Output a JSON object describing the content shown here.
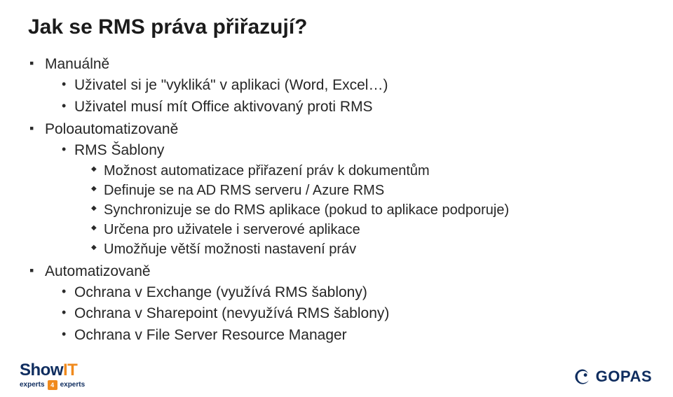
{
  "title": "Jak se RMS práva přiřazují?",
  "bullets": {
    "i0": {
      "label": "Manuálně",
      "sub": {
        "s0": "Uživatel si je \"vykliká\" v aplikaci (Word, Excel…)",
        "s1": "Uživatel musí mít Office aktivovaný proti RMS"
      }
    },
    "i1": {
      "label": "Poloautomatizovaně",
      "sub": {
        "s0": "RMS Šablony",
        "s0_sub": {
          "t0": "Možnost automatizace přiřazení práv k dokumentům",
          "t1": "Definuje se na AD RMS serveru / Azure RMS",
          "t2": "Synchronizuje se do RMS aplikace (pokud to aplikace podporuje)",
          "t3": "Určena pro uživatele i serverové aplikace",
          "t4": "Umožňuje větší možnosti nastavení práv"
        }
      }
    },
    "i2": {
      "label": "Automatizovaně",
      "sub": {
        "s0": "Ochrana v Exchange (využívá RMS šablony)",
        "s1": "Ochrana v Sharepoint (nevyužívá RMS šablony)",
        "s2": "Ochrana v File Server Resource Manager"
      }
    }
  },
  "footer": {
    "showit": {
      "show": "Show",
      "it": "IT",
      "experts": "experts",
      "four": "4",
      "experts2": "experts"
    },
    "gopas": "GOPAS"
  }
}
